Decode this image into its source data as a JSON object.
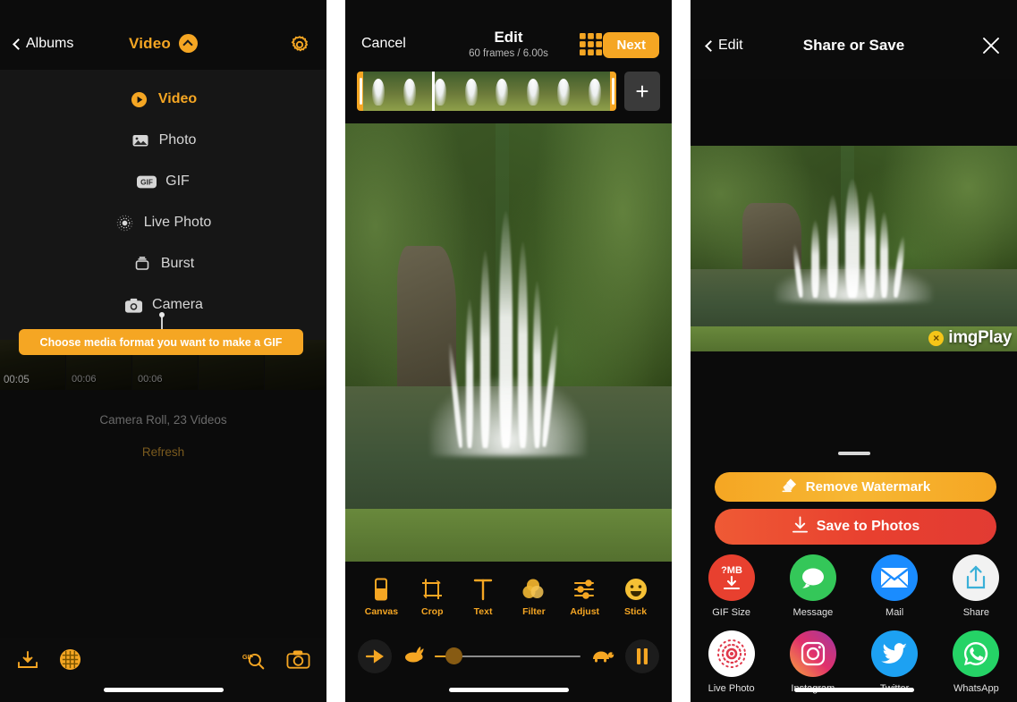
{
  "panel1": {
    "nav": {
      "back_label": "Albums",
      "title": "Video",
      "gear_icon": "gear-icon",
      "chevron_icon": "chevron-up-icon"
    },
    "dropdown": {
      "items": [
        {
          "label": "Video",
          "icon": "play-circle-icon",
          "selected": true
        },
        {
          "label": "Photo",
          "icon": "photo-icon",
          "selected": false
        },
        {
          "label": "GIF",
          "icon": "gif-badge-icon",
          "selected": false
        },
        {
          "label": "Live Photo",
          "icon": "live-photo-icon",
          "selected": false
        },
        {
          "label": "Burst",
          "icon": "burst-icon",
          "selected": false
        },
        {
          "label": "Camera",
          "icon": "camera-icon",
          "selected": false
        }
      ]
    },
    "tooltip": "Choose media format you want to make a GIF",
    "thumbnails": [
      {
        "duration": "00:05"
      },
      {
        "duration": "00:06"
      },
      {
        "duration": "00:06"
      }
    ],
    "library_info": "Camera Roll, 23 Videos",
    "refresh_label": "Refresh",
    "toolbar": {
      "import_icon": "import-download-icon",
      "waffle_icon": "waffle-grid-icon",
      "gif_search_icon": "gif-search-icon",
      "camera_icon": "camera-icon"
    }
  },
  "panel2": {
    "nav": {
      "cancel_label": "Cancel",
      "title": "Edit",
      "subtitle": "60 frames / 6.00s",
      "grid_icon": "grid-icon",
      "next_label": "Next"
    },
    "filmstrip": {
      "add_label": "+",
      "frame_count": 8
    },
    "tools": [
      {
        "label": "Canvas",
        "icon": "canvas-icon"
      },
      {
        "label": "Crop",
        "icon": "crop-icon"
      },
      {
        "label": "Text",
        "icon": "text-icon"
      },
      {
        "label": "Filter",
        "icon": "filter-icon"
      },
      {
        "label": "Adjust",
        "icon": "adjust-icon"
      },
      {
        "label": "Stick",
        "icon": "sticker-icon"
      }
    ],
    "playback": {
      "direction_icon": "play-direction-icon",
      "fast_icon": "rabbit-icon",
      "slow_icon": "turtle-icon",
      "pause_icon": "pause-icon",
      "speed_value": 8
    }
  },
  "panel3": {
    "nav": {
      "back_label": "Edit",
      "title": "Share or Save",
      "close_icon": "close-icon"
    },
    "watermark": {
      "text": "imɡPlay",
      "remove_icon": "close-badge-icon"
    },
    "actions": [
      {
        "label": "Remove Watermark",
        "icon": "eraser-icon",
        "color": "#f5a623"
      },
      {
        "label": "Save to Photos",
        "icon": "download-icon",
        "color": "#e8402f"
      }
    ],
    "share_items": [
      {
        "label": "GIF Size",
        "icon": "gif-size-icon",
        "badge": "?MB",
        "color": "#e8402f"
      },
      {
        "label": "Message",
        "icon": "message-icon",
        "color": "#34c759"
      },
      {
        "label": "Mail",
        "icon": "mail-icon",
        "color": "#1a8cff"
      },
      {
        "label": "Share",
        "icon": "share-icon",
        "color": "#f2f2f2"
      },
      {
        "label": "Live Photo",
        "icon": "live-photo-icon",
        "color": "#ffffff"
      },
      {
        "label": "Instagram",
        "icon": "instagram-icon",
        "color": "#e1306c"
      },
      {
        "label": "Twitter",
        "icon": "twitter-icon",
        "color": "#1da1f2"
      },
      {
        "label": "WhatsApp",
        "icon": "whatsapp-icon",
        "color": "#25d366"
      }
    ]
  },
  "colors": {
    "accent": "#f5a623",
    "background": "#0b0b0b",
    "danger": "#e8402f"
  }
}
